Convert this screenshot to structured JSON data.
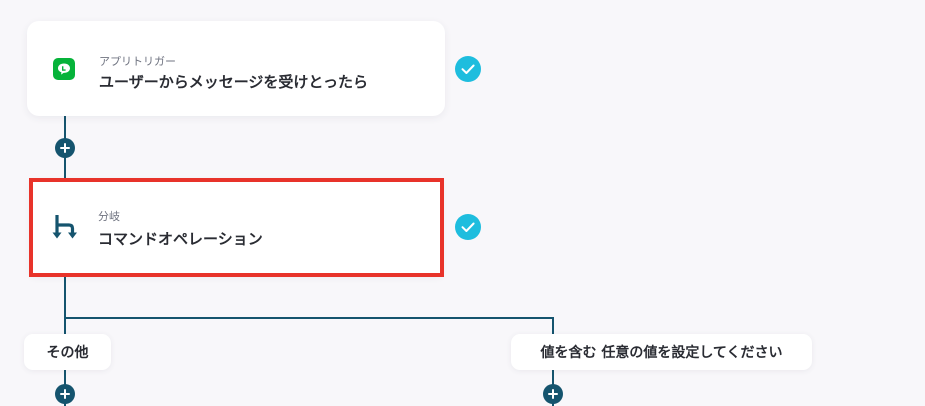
{
  "steps": [
    {
      "category": "アプリトリガー",
      "title": "ユーザーからメッセージを受けとったら",
      "icon": "line-app-icon",
      "status": "complete"
    },
    {
      "category": "分岐",
      "title": "コマンドオペレーション",
      "icon": "branch-icon",
      "status": "complete",
      "highlighted": true
    }
  ],
  "branches": [
    {
      "label": "その他"
    },
    {
      "label": "値を含む 任意の値を設定してください"
    }
  ],
  "colors": {
    "background": "#f8f7fa",
    "connector": "#15546e",
    "check": "#1ebdde",
    "line_app": "#06b33a",
    "highlight": "#e8332a"
  }
}
